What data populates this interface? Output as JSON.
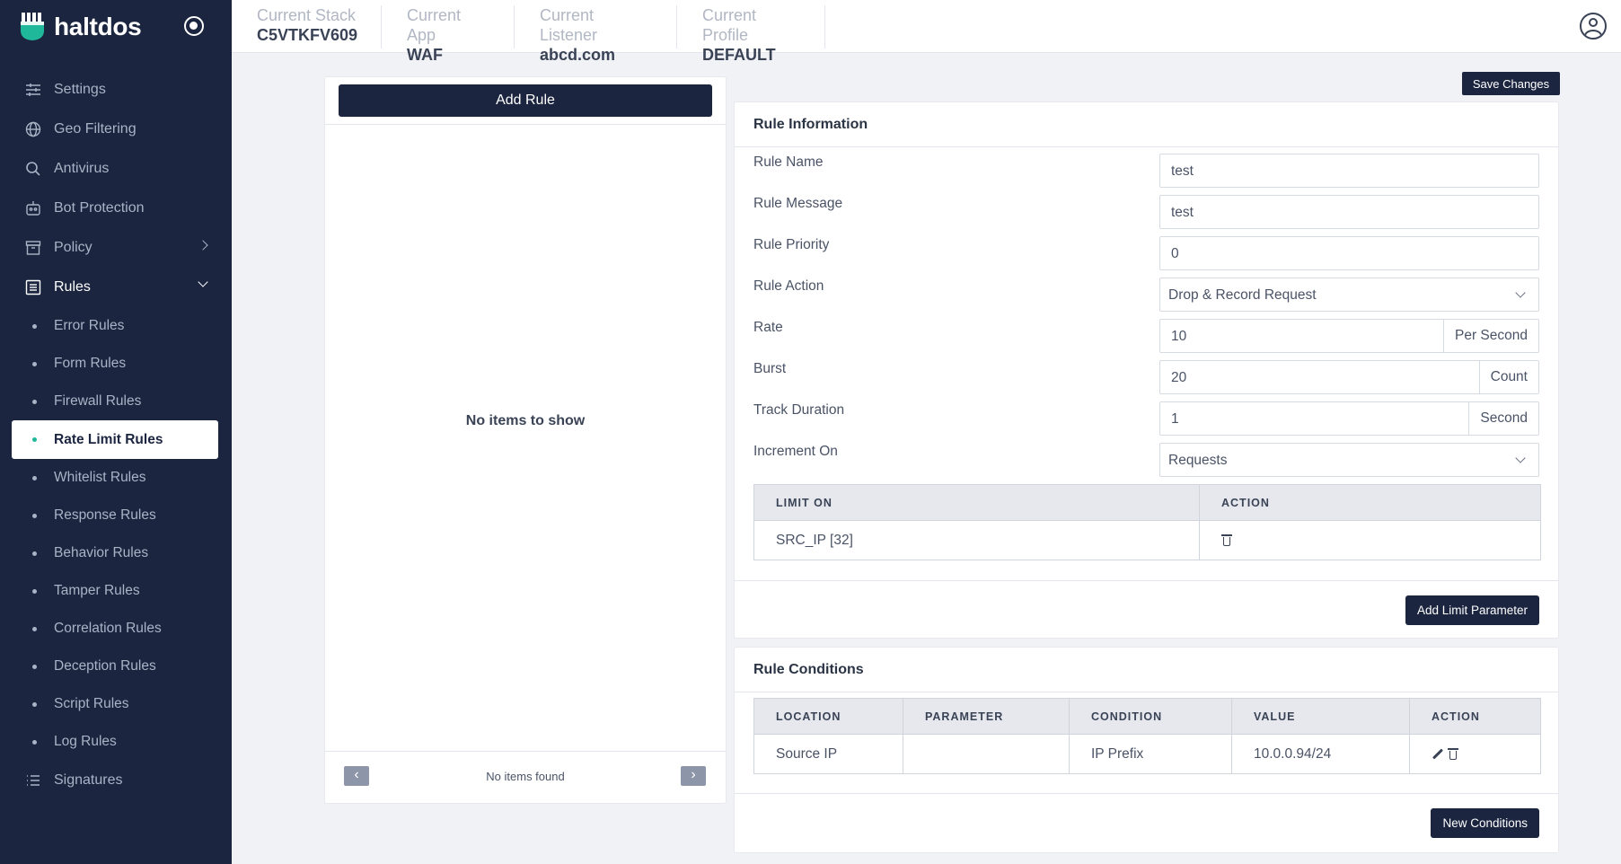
{
  "sidebar": {
    "brand": "haltdos",
    "items": [
      {
        "label": "Settings",
        "icon": "sliders-icon"
      },
      {
        "label": "Geo Filtering",
        "icon": "globe-icon"
      },
      {
        "label": "Antivirus",
        "icon": "search-icon"
      },
      {
        "label": "Bot Protection",
        "icon": "robot-icon"
      },
      {
        "label": "Policy",
        "icon": "archive-icon"
      },
      {
        "label": "Rules",
        "icon": "list-icon"
      }
    ],
    "rules_sub": [
      "Error Rules",
      "Form Rules",
      "Firewall Rules",
      "Rate Limit Rules",
      "Whitelist Rules",
      "Response Rules",
      "Behavior Rules",
      "Tamper Rules",
      "Correlation Rules",
      "Deception Rules",
      "Script Rules",
      "Log Rules"
    ],
    "signatures": {
      "label": "Signatures",
      "icon": "bullet-list-icon"
    },
    "active_item": "Rate Limit Rules"
  },
  "header": {
    "stack": {
      "label": "Current Stack",
      "value": "C5VTKFV609"
    },
    "app": {
      "label": "Current App",
      "value": "WAF"
    },
    "listener": {
      "label": "Current Listener",
      "value": "abcd.com"
    },
    "profile": {
      "label": "Current Profile",
      "value": "DEFAULT"
    }
  },
  "list_panel": {
    "add_rule": "Add Rule",
    "empty": "No items to show",
    "footer": "No items found",
    "prev": "‹",
    "next": "›"
  },
  "save_changes": "Save Changes",
  "rule_info": {
    "title": "Rule Information",
    "fields": [
      {
        "label": "Rule Name",
        "value": "test"
      },
      {
        "label": "Rule Message",
        "value": "test"
      },
      {
        "label": "Rule Priority",
        "value": "0"
      },
      {
        "label": "Rule Action",
        "value": "Drop & Record Request"
      },
      {
        "label": "Rate",
        "value": "10",
        "unit": "Per Second"
      },
      {
        "label": "Burst",
        "value": "20",
        "unit": "Count"
      },
      {
        "label": "Track Duration",
        "value": "1",
        "unit": "Second"
      },
      {
        "label": "Increment On",
        "value": "Requests"
      }
    ],
    "limit_table": {
      "headers": [
        "LIMIT ON",
        "ACTION"
      ],
      "rows": [
        [
          "SRC_IP [32]"
        ]
      ]
    },
    "add_limit": "Add Limit Parameter"
  },
  "rule_conditions": {
    "title": "Rule Conditions",
    "headers": [
      "LOCATION",
      "PARAMETER",
      "CONDITION",
      "VALUE",
      "ACTION"
    ],
    "rows": [
      [
        "Source IP",
        "",
        "IP Prefix",
        "10.0.0.94/24"
      ]
    ],
    "new_conditions": "New Conditions"
  },
  "colors": {
    "sidebar_bg": "#1b2540",
    "accent": "#1fb89a"
  }
}
